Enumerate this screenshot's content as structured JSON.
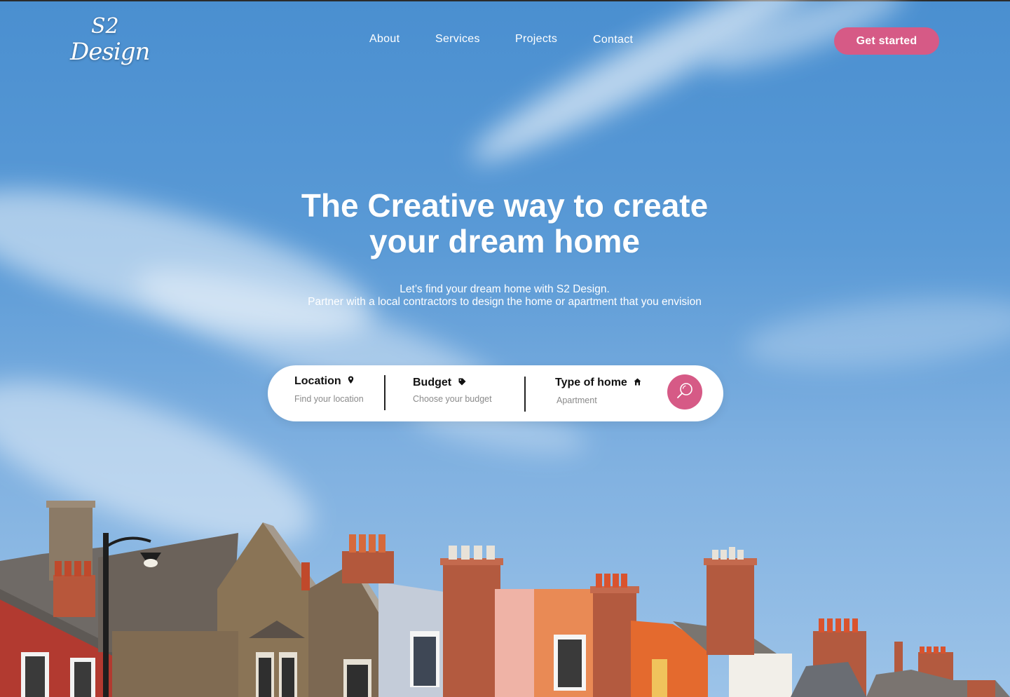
{
  "brand": {
    "logo_line1": "S2",
    "logo_line2": "Design"
  },
  "nav": {
    "items": [
      {
        "label": "About"
      },
      {
        "label": "Services"
      },
      {
        "label": "Projects"
      },
      {
        "label": "Contact"
      }
    ],
    "cta_label": "Get started"
  },
  "hero": {
    "title_line1": "The Creative way to create",
    "title_line2": "your dream home",
    "subtitle_line1": "Let’s find your dream home with S2 Design.",
    "subtitle_line2": "Partner with a local contractors to design the home or apartment that you envision"
  },
  "search": {
    "location": {
      "label": "Location",
      "placeholder": "Find your location",
      "icon": "map-pin-icon"
    },
    "budget": {
      "label": "Budget",
      "placeholder": "Choose your budget",
      "icon": "tag-icon"
    },
    "home_type": {
      "label": "Type of home",
      "value": "Apartment",
      "icon": "house-icon"
    },
    "button_icon": "search-icon"
  },
  "colors": {
    "accent": "#d65a86",
    "sky": "#4a8fd0",
    "text_on_sky": "#ffffff"
  }
}
